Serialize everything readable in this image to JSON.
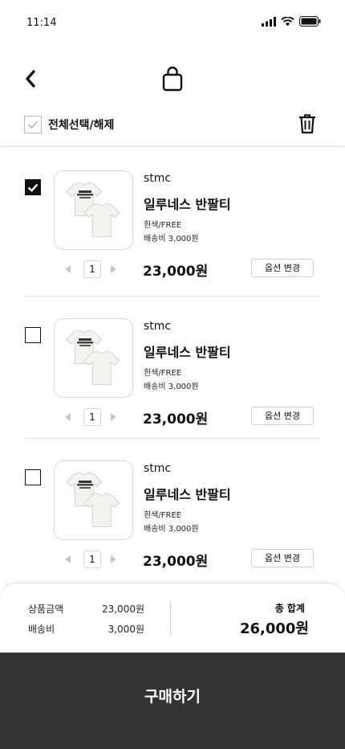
{
  "status_bar": {
    "time": "11:14"
  },
  "select_all": {
    "label": "전체선택/해제"
  },
  "items": [
    {
      "brand": "stmc",
      "name": "일루네스 반팔티",
      "option": "흰색/FREE",
      "shipping": "배송비 3,000원",
      "quantity": "1",
      "price": "23,000원",
      "option_button": "옵션 변경",
      "checked": true
    },
    {
      "brand": "stmc",
      "name": "일루네스 반팔티",
      "option": "흰색/FREE",
      "shipping": "배송비 3,000원",
      "quantity": "1",
      "price": "23,000원",
      "option_button": "옵션 변경",
      "checked": false
    },
    {
      "brand": "stmc",
      "name": "일루네스 반팔티",
      "option": "흰색/FREE",
      "shipping": "배송비 3,000원",
      "quantity": "1",
      "price": "23,000원",
      "option_button": "옵션 변경",
      "checked": false
    }
  ],
  "summary": {
    "product_label": "상품금액",
    "product_value": "23,000원",
    "shipping_label": "배송비",
    "shipping_value": "3,000원",
    "total_label": "총 합계",
    "total_value": "26,000원"
  },
  "buy_button": {
    "label": "구매하기"
  },
  "colors": {
    "buy_bar": "#333333",
    "checked_box": "#111111",
    "divider": "#e3e3e3"
  },
  "icons": [
    "back-arrow-icon",
    "shopping-bag-icon",
    "trash-icon",
    "signal-icon",
    "wifi-icon",
    "battery-icon",
    "checkmark-icon"
  ]
}
